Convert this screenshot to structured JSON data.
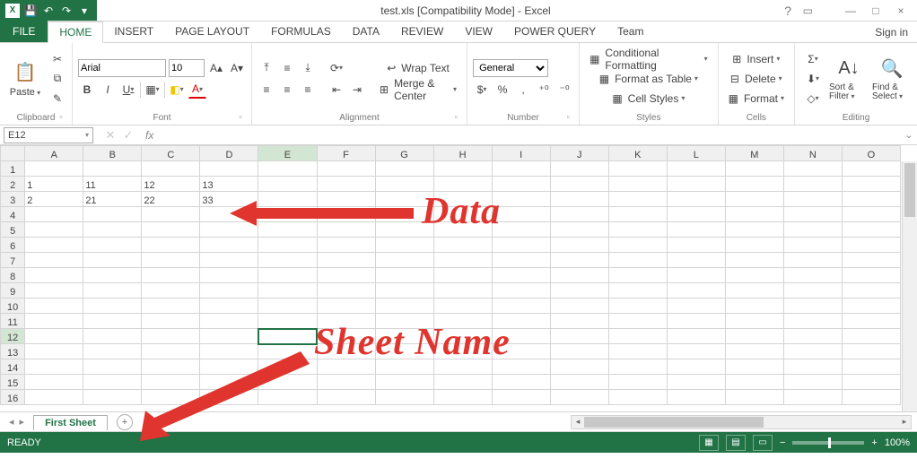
{
  "window": {
    "title": "test.xls  [Compatibility Mode] - Excel",
    "help_tip": "?",
    "minimize": "—",
    "maximize": "□",
    "close": "×",
    "signin": "Sign in"
  },
  "qat": {
    "app": "X",
    "save": "💾",
    "undo": "↶",
    "redo": "↷",
    "customize": "▾"
  },
  "tabs": {
    "file": "FILE",
    "items": [
      "HOME",
      "INSERT",
      "PAGE LAYOUT",
      "FORMULAS",
      "DATA",
      "REVIEW",
      "VIEW",
      "POWER QUERY",
      "Team"
    ],
    "active_index": 0
  },
  "ribbon": {
    "clipboard": {
      "label": "Clipboard",
      "paste": "Paste",
      "cut": "✂",
      "copy": "⧉",
      "fmtpainter": "✎"
    },
    "font": {
      "label": "Font",
      "name": "Arial",
      "size": "10",
      "grow": "A▴",
      "shrink": "A▾",
      "bold": "B",
      "italic": "I",
      "underline": "U",
      "borders": "▦",
      "fill": "◧",
      "color": "A"
    },
    "alignment": {
      "label": "Alignment",
      "wrap": "Wrap Text",
      "merge": "Merge & Center"
    },
    "number": {
      "label": "Number",
      "format": "General",
      "currency": "$",
      "percent": "%",
      "comma": ",",
      "inc": "⁺⁰",
      "dec": "⁻⁰"
    },
    "styles": {
      "label": "Styles",
      "cond": "Conditional Formatting",
      "table": "Format as Table",
      "cell": "Cell Styles"
    },
    "cells": {
      "label": "Cells",
      "insert": "Insert",
      "delete": "Delete",
      "format": "Format"
    },
    "editing": {
      "label": "Editing",
      "sum": "Σ",
      "fill": "⬇",
      "clear": "◇",
      "sort": "Sort & Filter",
      "find": "Find & Select"
    }
  },
  "namebox": {
    "ref": "E12"
  },
  "formula": {
    "fx": "fx",
    "value": "",
    "cancel": "✕",
    "enter": "✓"
  },
  "grid": {
    "cols": [
      "A",
      "B",
      "C",
      "D",
      "E",
      "F",
      "G",
      "H",
      "I",
      "J",
      "K",
      "L",
      "M",
      "N",
      "O"
    ],
    "rows": 16,
    "selected": {
      "col": "E",
      "row": 12
    },
    "cells": {
      "2": {
        "A": "1",
        "B": "11",
        "C": "12",
        "D": "13"
      },
      "3": {
        "A": "2",
        "B": "21",
        "C": "22",
        "D": "33"
      }
    }
  },
  "sheets": {
    "nav_prev": "◂",
    "nav_next": "▸",
    "active": "First Sheet",
    "add": "+"
  },
  "status": {
    "mode": "READY",
    "zoom": "100%",
    "minus": "−",
    "plus": "+"
  },
  "annotations": {
    "data_label": "Data",
    "sheet_label": "Sheet Name"
  }
}
